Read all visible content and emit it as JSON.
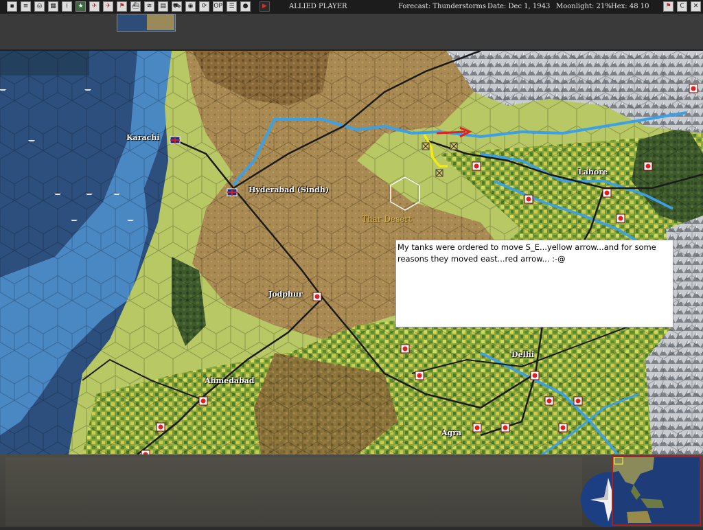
{
  "toolbar": {
    "buttons": [
      {
        "icon": "square-icon",
        "glyph": "▪"
      },
      {
        "icon": "document-icon",
        "glyph": "≡"
      },
      {
        "icon": "globe-icon",
        "glyph": "◎"
      },
      {
        "icon": "grid-icon",
        "glyph": "▦"
      },
      {
        "icon": "info-icon",
        "glyph": "i"
      },
      {
        "icon": "star-icon",
        "glyph": "★"
      },
      {
        "icon": "plane-icon",
        "glyph": "✈"
      },
      {
        "icon": "aircraft-icon",
        "glyph": "✈"
      },
      {
        "icon": "flag-icon",
        "glyph": "⚑"
      },
      {
        "icon": "ship-icon",
        "glyph": "⛴"
      },
      {
        "icon": "convoy-icon",
        "glyph": "≋"
      },
      {
        "icon": "map-icon",
        "glyph": "▤"
      },
      {
        "icon": "cargo-icon",
        "glyph": "⛟"
      },
      {
        "icon": "world-icon",
        "glyph": "◉"
      },
      {
        "icon": "refresh-icon",
        "glyph": "⟳"
      },
      {
        "icon": "op-icon",
        "glyph": "OP"
      },
      {
        "icon": "list-icon",
        "glyph": "☰"
      },
      {
        "icon": "moon-icon",
        "glyph": "●"
      },
      {
        "icon": "play-icon",
        "glyph": "▶"
      }
    ],
    "player": "ALLIED PLAYER",
    "forecast": "Forecast: Thunderstorms",
    "date": "Date: Dec 1, 1943",
    "moonlight": "Moonlight: 21%",
    "hex": "Hex: 48 10",
    "right_buttons": [
      {
        "icon": "flag-icon",
        "glyph": "⚑"
      },
      {
        "icon": "c-icon",
        "glyph": "C"
      },
      {
        "icon": "close-icon",
        "glyph": "✕"
      }
    ]
  },
  "map": {
    "cities": [
      {
        "name": "Karachi"
      },
      {
        "name": "Hyderabad (Sindh)"
      },
      {
        "name": "Lahore"
      },
      {
        "name": "Jodphur"
      },
      {
        "name": "Delhi"
      },
      {
        "name": "Ahmedabad"
      },
      {
        "name": "Agra"
      }
    ],
    "region_label": "Thar Desert"
  },
  "note": {
    "text": "My tanks were ordered to move S_E...yellow arrow...and for some reasons they moved east...red arrow... :-@"
  },
  "colors": {
    "ocean_deep": "#2d4f7e",
    "ocean_shallow": "#4a88c4",
    "desert": "#a98a52",
    "grassland": "#b8c864",
    "farmland": "#8aa83c",
    "mountain": "#c9ccd0",
    "river": "#3aa0e8",
    "road": "#1a1a1a",
    "japanese_unit": "#e02020",
    "yellow_arrow": "#f2ea10",
    "red_arrow": "#e62020"
  }
}
